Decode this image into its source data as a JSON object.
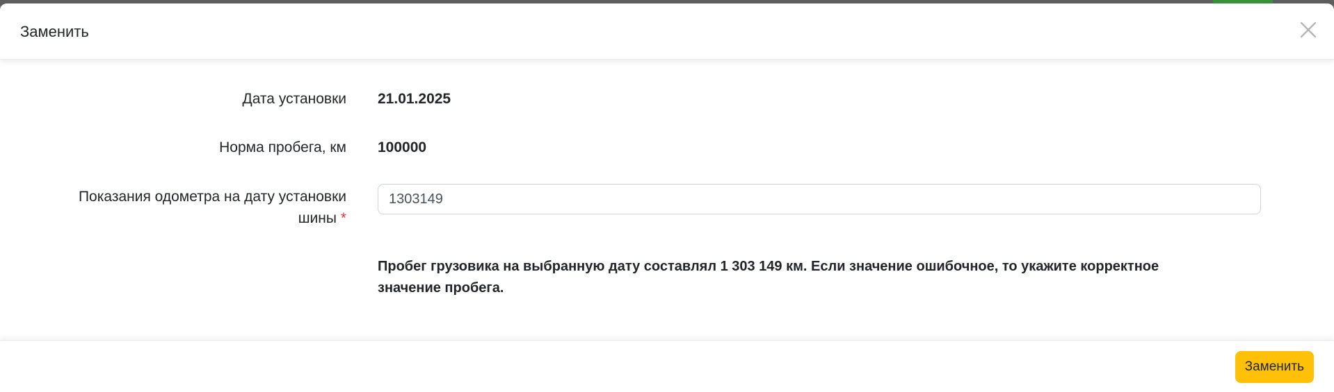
{
  "modal": {
    "title": "Заменить",
    "close_icon": "close-icon"
  },
  "form": {
    "install_date": {
      "label": "Дата установки",
      "value": "21.01.2025"
    },
    "mileage_norm": {
      "label": "Норма пробега, км",
      "value": "100000"
    },
    "odometer": {
      "label_line1": "Показания одометра на дату установки",
      "label_line2": "шины",
      "required_mark": "*",
      "value": "1303149"
    },
    "notice": "Пробег грузовика на выбранную дату составлял 1 303 149 км. Если значение ошибочное, то укажите корректное значение пробега."
  },
  "footer": {
    "submit_label": "Заменить"
  },
  "colors": {
    "accent": "#ffc107",
    "required": "#dc3545"
  }
}
